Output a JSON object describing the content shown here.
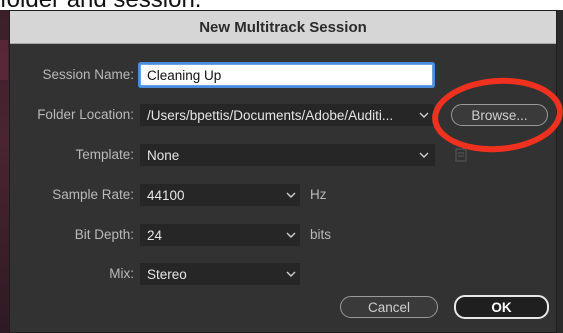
{
  "background": {
    "cropped_text": "folder and session."
  },
  "dialog": {
    "title": "New Multitrack Session",
    "session_name": {
      "label": "Session Name:",
      "value": "Cleaning Up"
    },
    "folder_location": {
      "label": "Folder Location:",
      "value": "/Users/bpettis/Documents/Adobe/Auditi..."
    },
    "browse_button": "Browse...",
    "template": {
      "label": "Template:",
      "value": "None"
    },
    "sample_rate": {
      "label": "Sample Rate:",
      "value": "44100",
      "unit": "Hz"
    },
    "bit_depth": {
      "label": "Bit Depth:",
      "value": "24",
      "unit": "bits"
    },
    "mix": {
      "label": "Mix:",
      "value": "Stereo"
    },
    "cancel_button": "Cancel",
    "ok_button": "OK"
  },
  "colors": {
    "annotation": "#f0311f",
    "dialog_bg": "#323232",
    "focus": "#4b8cde"
  },
  "icons": {
    "dropdown": "chevron-down-icon",
    "template_info": "document-icon"
  }
}
